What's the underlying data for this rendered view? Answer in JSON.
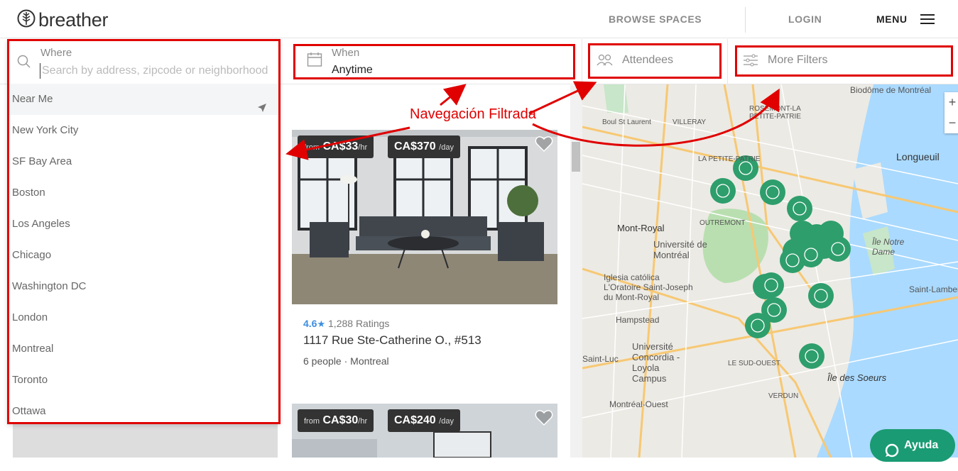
{
  "header": {
    "logo_text": "breather",
    "browse_spaces": "BROWSE SPACES",
    "login": "LOGIN",
    "menu": "MENU"
  },
  "search": {
    "where_label": "Where",
    "placeholder": "Search by address, zipcode or neighborhood",
    "cities": [
      "Near Me",
      "New York City",
      "SF Bay Area",
      "Boston",
      "Los Angeles",
      "Chicago",
      "Washington DC",
      "London",
      "Montreal",
      "Toronto",
      "Ottawa"
    ]
  },
  "filters": {
    "when_label": "When",
    "when_value": "Anytime",
    "attendees": "Attendees",
    "more_filters": "More Filters"
  },
  "annotation": "Navegación Filtrada",
  "listings": [
    {
      "from_label": "from",
      "hourly": "CA$33",
      "hourly_unit": "/hr",
      "daily": "CA$370",
      "daily_unit": "/day",
      "rating": "4.6",
      "ratings_count": "1,288 Ratings",
      "address": "1117 Rue Ste-Catherine O., #513",
      "capacity": "6 people",
      "city": "Montreal"
    },
    {
      "from_label": "from",
      "hourly": "CA$30",
      "hourly_unit": "/hr",
      "daily": "CA$240",
      "daily_unit": "/day"
    }
  ],
  "map": {
    "labels": [
      "Biodôme de Montréal",
      "ROSEMONT-LA PETITE-PATRIE",
      "Longueuil",
      "Mont-Royal",
      "OUTREMONT",
      "Université de Montréal",
      "Île Notre Dame",
      "Iglesia católica L'Oratoire Saint-Joseph du Mont-Royal",
      "Saint-Lambert",
      "Hampstead",
      "Université Concordia - Loyola Campus",
      "Saint-Luc",
      "LE SUD-OUEST",
      "Île des Soeurs",
      "Montréal-Ouest",
      "VERDUN",
      "Boul St Laurent",
      "VILLERAY",
      "LA PETITE-PATRIE"
    ],
    "zoom_in": "+",
    "zoom_out": "−"
  },
  "chat": {
    "label": "Ayuda"
  },
  "colors": {
    "brand_green": "#1a9b73",
    "annotation_red": "#e00000",
    "rating_blue": "#3d8ee0"
  }
}
